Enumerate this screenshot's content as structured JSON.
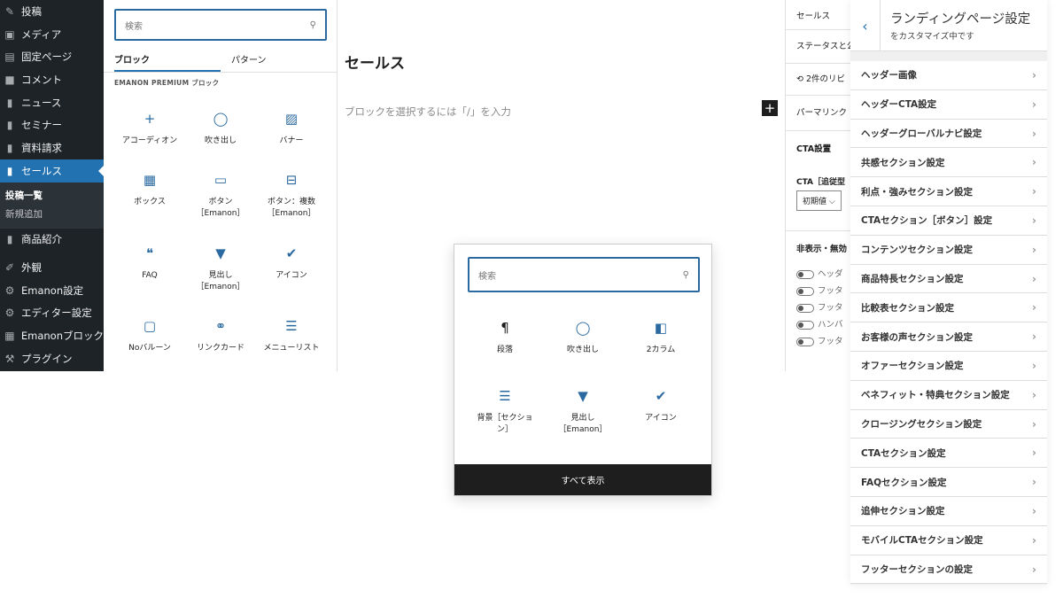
{
  "wp_menu": {
    "items": [
      {
        "icon": "pin-icon",
        "label": "投稿"
      },
      {
        "icon": "media-icon",
        "label": "メディア"
      },
      {
        "icon": "page-icon",
        "label": "固定ページ"
      },
      {
        "icon": "comment-icon",
        "label": "コメント"
      },
      {
        "icon": "post-icon",
        "label": "ニュース"
      },
      {
        "icon": "post-icon",
        "label": "セミナー"
      },
      {
        "icon": "post-icon",
        "label": "資料請求"
      },
      {
        "icon": "post-icon",
        "label": "セールス"
      }
    ],
    "submenu": [
      "投稿一覧",
      "新規追加"
    ],
    "items_after": [
      {
        "icon": "post-icon",
        "label": "商品紹介"
      },
      {
        "icon": "brush-icon",
        "label": "外観"
      },
      {
        "icon": "gear-icon",
        "label": "Emanon設定"
      },
      {
        "icon": "gear-icon",
        "label": "エディター設定"
      },
      {
        "icon": "grid-icon",
        "label": "Emanonブロック"
      },
      {
        "icon": "plugin-icon",
        "label": "プラグイン"
      }
    ]
  },
  "inserter": {
    "search_placeholder": "検索",
    "tabs": [
      "ブロック",
      "パターン"
    ],
    "section_title": "EMANON PREMIUM ブロック",
    "blocks": [
      {
        "icon": "plus-icon",
        "label": "アコーディオン"
      },
      {
        "icon": "speech-bubble-icon",
        "label": "吹き出し"
      },
      {
        "icon": "image-icon",
        "label": "バナー"
      },
      {
        "icon": "box-icon",
        "label": "ボックス"
      },
      {
        "icon": "button-icon",
        "label": "ボタン\n［Emanon］"
      },
      {
        "icon": "buttons-icon",
        "label": "ボタン：複数\n［Emanon］"
      },
      {
        "icon": "faq-icon",
        "label": "FAQ"
      },
      {
        "icon": "bookmark-icon",
        "label": "見出し\n［Emanon］"
      },
      {
        "icon": "check-icon",
        "label": "アイコン"
      },
      {
        "icon": "balloon-icon",
        "label": "Noバルーン"
      },
      {
        "icon": "link-icon",
        "label": "リンクカード"
      },
      {
        "icon": "list-icon",
        "label": "メニューリスト"
      }
    ]
  },
  "editor": {
    "title": "セールス",
    "placeholder": "ブロックを選択するには「/」を入力"
  },
  "settings": {
    "tab": "セールス",
    "status": "ステータスと公",
    "revisions": "2件のリビ",
    "permalink": "パーマリンク",
    "cta_heading": "CTA設置",
    "cta_label": "CTA［追従型",
    "cta_select": "初期値",
    "hide_heading": "非表示・無効",
    "toggles": [
      "ヘッダ",
      "フッタ",
      "フッタ",
      "ハンバ",
      "フッタ"
    ]
  },
  "customizer": {
    "title": "ランディングページ設定",
    "subtitle": "をカスタマイズ中です",
    "items": [
      "ヘッダー画像",
      "ヘッダーCTA設定",
      "ヘッダーグローバルナビ設定",
      "共感セクション設定",
      "利点・強みセクション設定",
      "CTAセクション［ボタン］設定",
      "コンテンツセクション設定",
      "商品特長セクション設定",
      "比較表セクション設定",
      "お客様の声セクション設定",
      "オファーセクション設定",
      "ベネフィット・特典セクション設定",
      "クロージングセクション設定",
      "CTAセクション設定",
      "FAQセクション設定",
      "追伸セクション設定",
      "モバイルCTAセクション設定",
      "フッターセクションの設定"
    ]
  },
  "popover": {
    "search_placeholder": "検索",
    "blocks": [
      {
        "icon": "paragraph-icon",
        "label": "段落"
      },
      {
        "icon": "speech-bubble-icon",
        "label": "吹き出し"
      },
      {
        "icon": "columns-icon",
        "label": "2カラム"
      },
      {
        "icon": "section-icon",
        "label": "背景［セクション］"
      },
      {
        "icon": "bookmark-icon",
        "label": "見出し\n［Emanon］"
      },
      {
        "icon": "check-icon",
        "label": "アイコン"
      }
    ],
    "show_all": "すべて表示"
  },
  "colors": {
    "accent": "#2271b1",
    "admin_bg": "#1d2327"
  }
}
